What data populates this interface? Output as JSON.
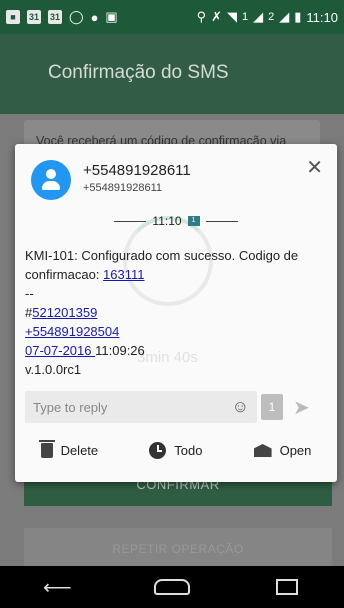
{
  "status_bar": {
    "icons": [
      "calendar-icon",
      "calendar-icon",
      "whatsapp-icon",
      "app-icon",
      "gallery-icon",
      "location-icon",
      "bluetooth-icon",
      "wifi-icon",
      "signal-icon",
      "signal-icon",
      "battery-icon"
    ],
    "cal1": "31",
    "cal2": "31",
    "sig1": "1",
    "sig2": "2",
    "time": "11:10"
  },
  "app": {
    "title": "Confirmação do SMS",
    "card_text": "Você receberá um código de confirmação via SMS. Este processo pode demorar até 5",
    "timer": "3min 40s",
    "confirm_label": "CONFIRMAR",
    "repeat_label": "REPETIR OPERAÇÃO"
  },
  "popup": {
    "sender": "+554891928611",
    "sender_sub": "+554891928611",
    "time": "11:10",
    "sim_label": "1",
    "message": {
      "line1": "KMI-101: Configurado com sucesso. Codigo de confirmacao: ",
      "code": "163111",
      "sep": "--",
      "hash_prefix": "#",
      "hash_link": "521201359",
      "phone": "+554891928504",
      "date": "07-07-2016 ",
      "time": "11:09:26",
      "version": "v.1.0.0rc1"
    },
    "reply_placeholder": "Type to reply",
    "reply_sim": "1",
    "actions": {
      "delete": "Delete",
      "todo": "Todo",
      "open": "Open"
    }
  },
  "colors": {
    "status_bar": "#1e5a3a",
    "avatar": "#2196f3",
    "link": "#1a1ab0",
    "confirm_button": "#2f5d43"
  }
}
